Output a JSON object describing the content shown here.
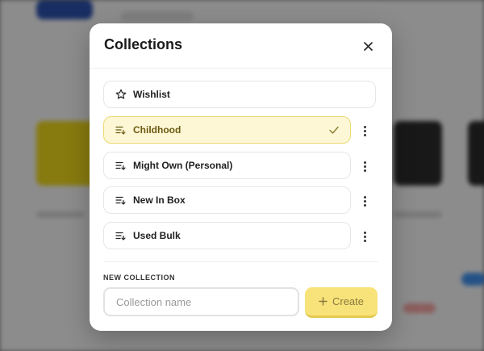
{
  "modal": {
    "title": "Collections",
    "collections": [
      {
        "label": "Wishlist",
        "icon": "star-icon",
        "selected": false,
        "has_menu": false
      },
      {
        "label": "Childhood",
        "icon": "list-icon",
        "selected": true,
        "has_menu": true
      },
      {
        "label": "Might Own (Personal)",
        "icon": "list-icon",
        "selected": false,
        "has_menu": true
      },
      {
        "label": "New In Box",
        "icon": "list-icon",
        "selected": false,
        "has_menu": true
      },
      {
        "label": "Used Bulk",
        "icon": "list-icon",
        "selected": false,
        "has_menu": true
      }
    ],
    "new_collection": {
      "heading": "NEW COLLECTION",
      "placeholder": "Collection name",
      "value": "",
      "create_label": "Create"
    }
  },
  "colors": {
    "accent": "#f7e37a",
    "selected_bg": "#fdf7d6",
    "selected_border": "#ecd970"
  }
}
